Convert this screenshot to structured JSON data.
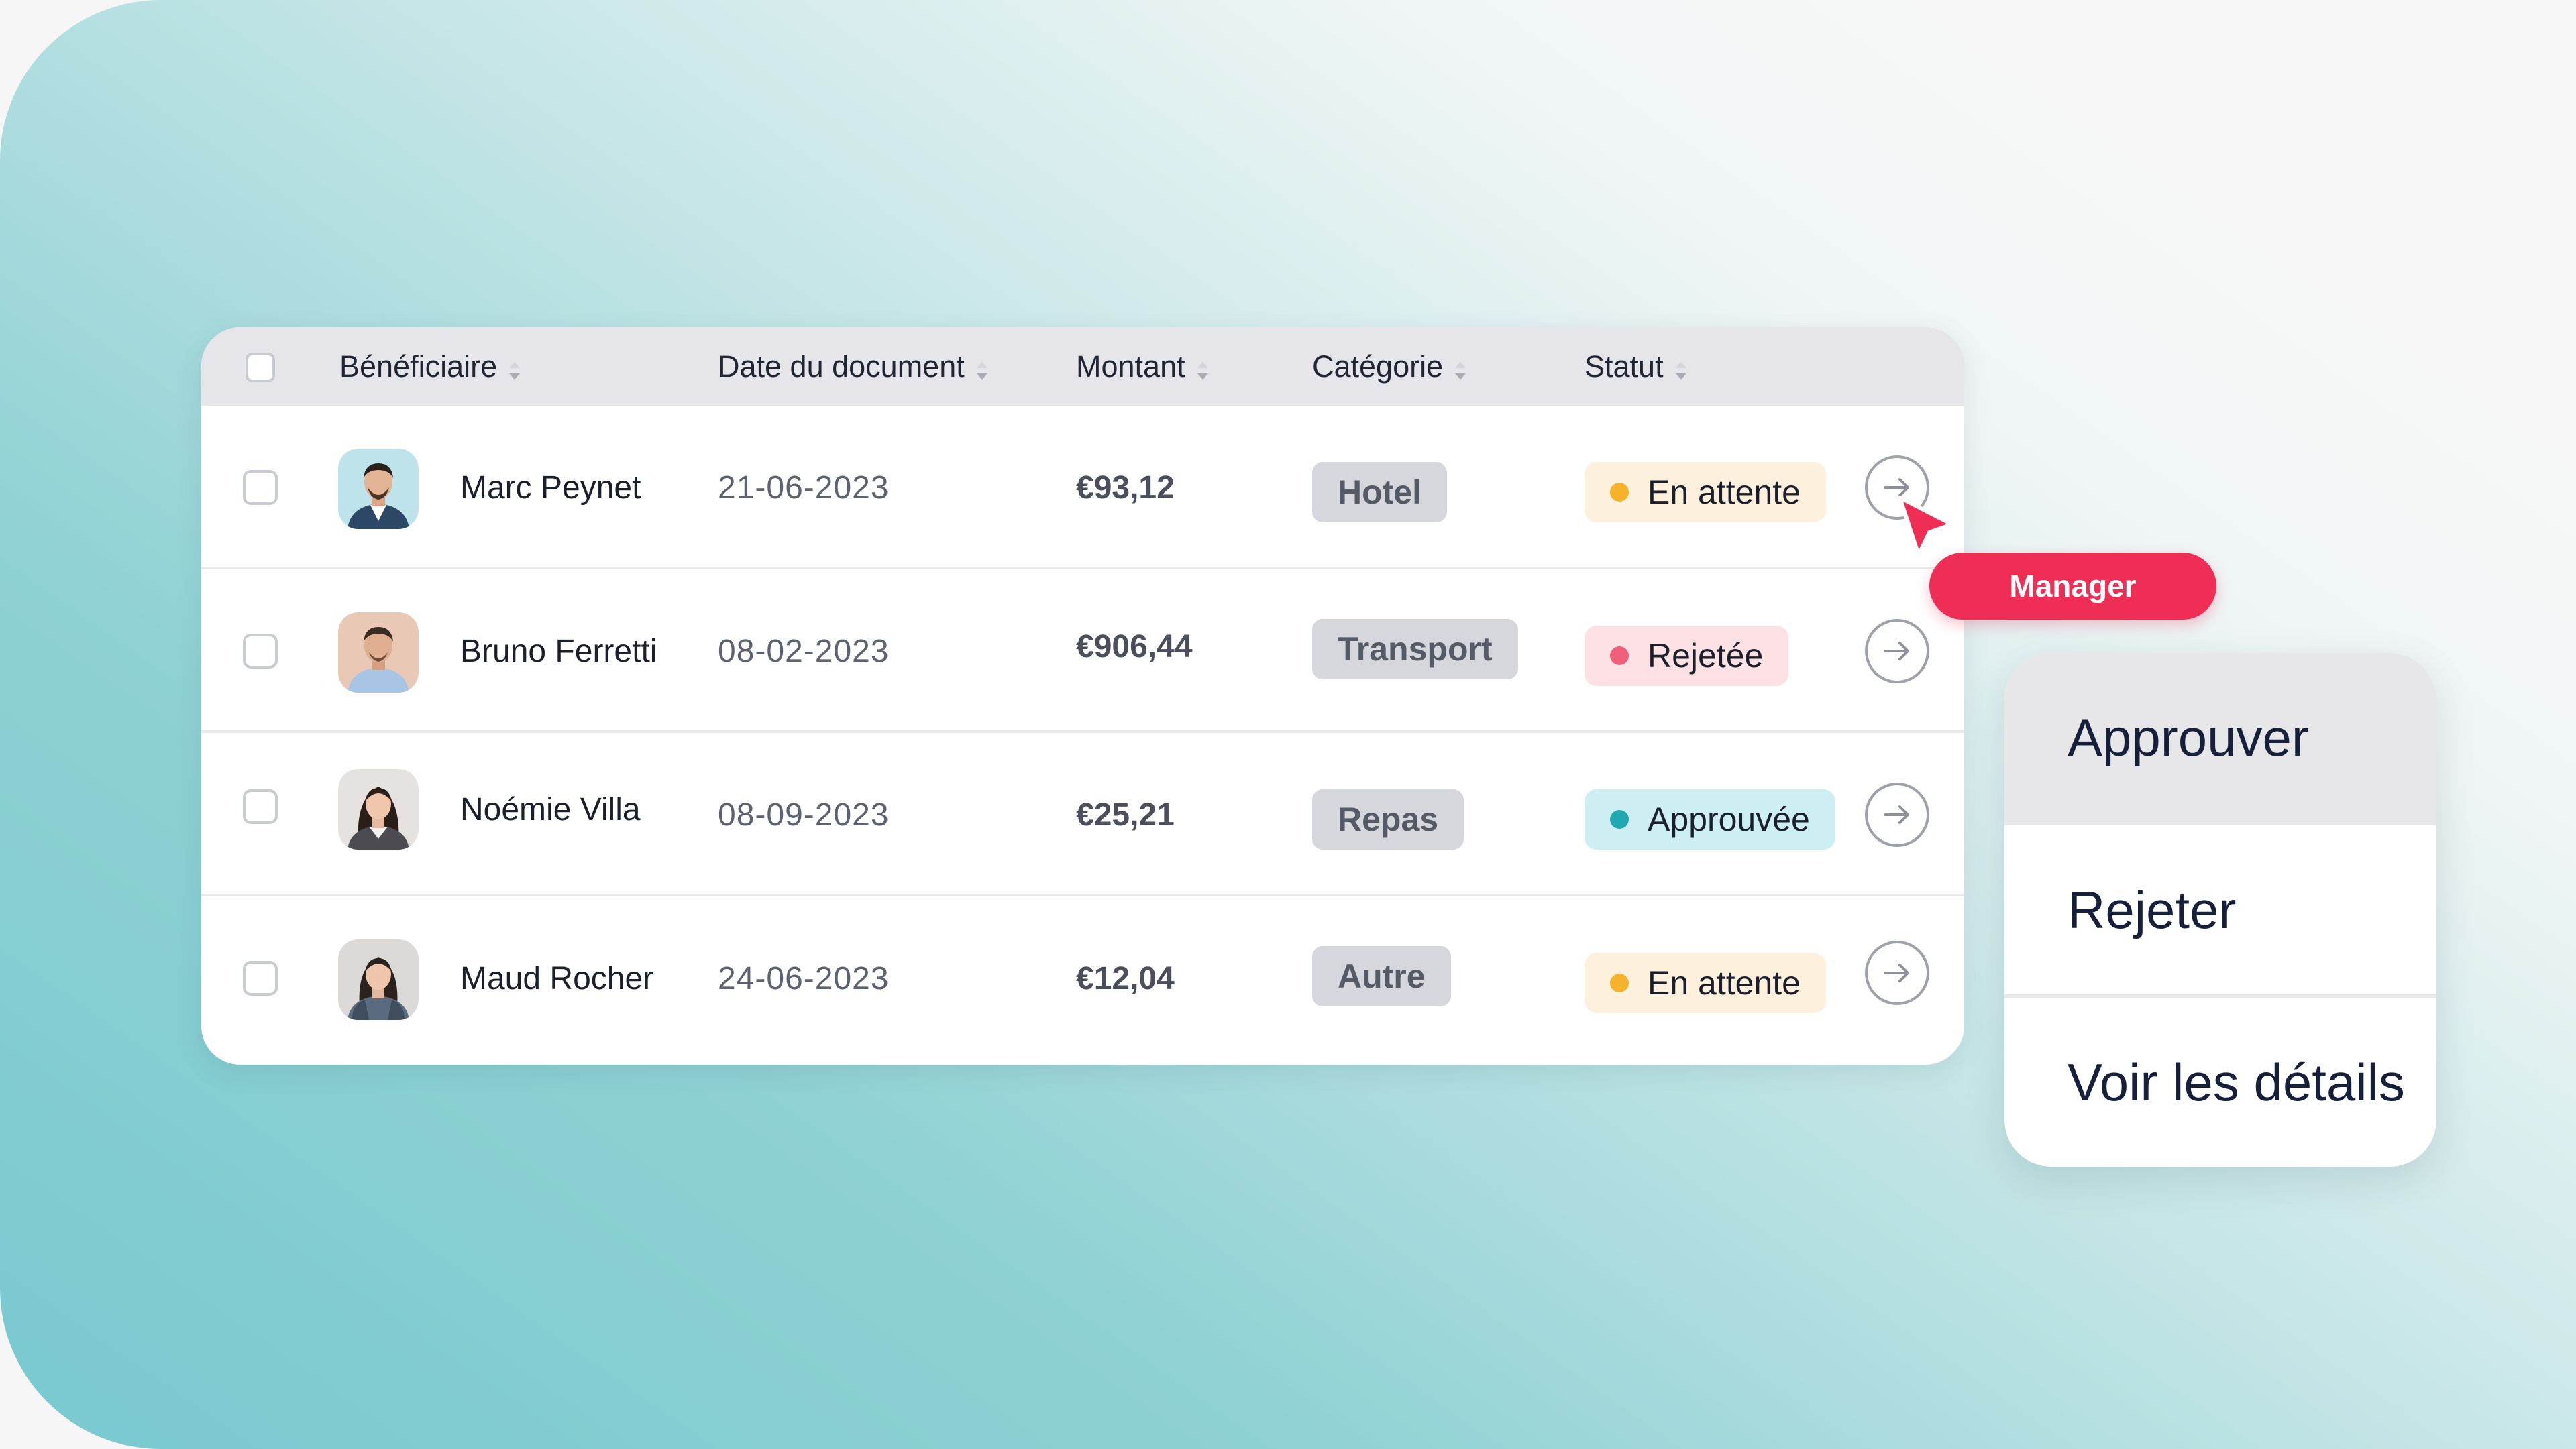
{
  "table": {
    "headers": {
      "beneficiary": "Bénéficiaire",
      "date": "Date du document",
      "amount": "Montant",
      "category": "Catégorie",
      "status": "Statut"
    },
    "rows": [
      {
        "name": "Marc Peynet",
        "date": "21-06-2023",
        "amount": "€93,12",
        "category": "Hotel",
        "status": "En attente",
        "status_type": "pending"
      },
      {
        "name": "Bruno Ferretti",
        "date": "08-02-2023",
        "amount": "€906,44",
        "category": "Transport",
        "status": "Rejetée",
        "status_type": "rejected"
      },
      {
        "name": "Noémie Villa",
        "date": "08-09-2023",
        "amount": "€25,21",
        "category": "Repas",
        "status": "Approuvée",
        "status_type": "approved"
      },
      {
        "name": "Maud Rocher",
        "date": "24-06-2023",
        "amount": "€12,04",
        "category": "Autre",
        "status": "En attente",
        "status_type": "pending"
      }
    ]
  },
  "cursor_tag": {
    "label": "Manager"
  },
  "context_menu": {
    "items": [
      {
        "label": "Approuver",
        "highlighted": true
      },
      {
        "label": "Rejeter",
        "highlighted": false
      },
      {
        "label": "Voir les détails",
        "highlighted": false
      }
    ]
  },
  "colors": {
    "accent": "#ef2e55",
    "teal": "#78c9cf",
    "status_pending": "#f6b22a",
    "status_rejected": "#f0607a",
    "status_approved": "#21a9b2"
  },
  "icons": {
    "sort": "sort-icon",
    "row_action": "arrow-right-icon",
    "cursor": "cursor-pointer-icon"
  }
}
